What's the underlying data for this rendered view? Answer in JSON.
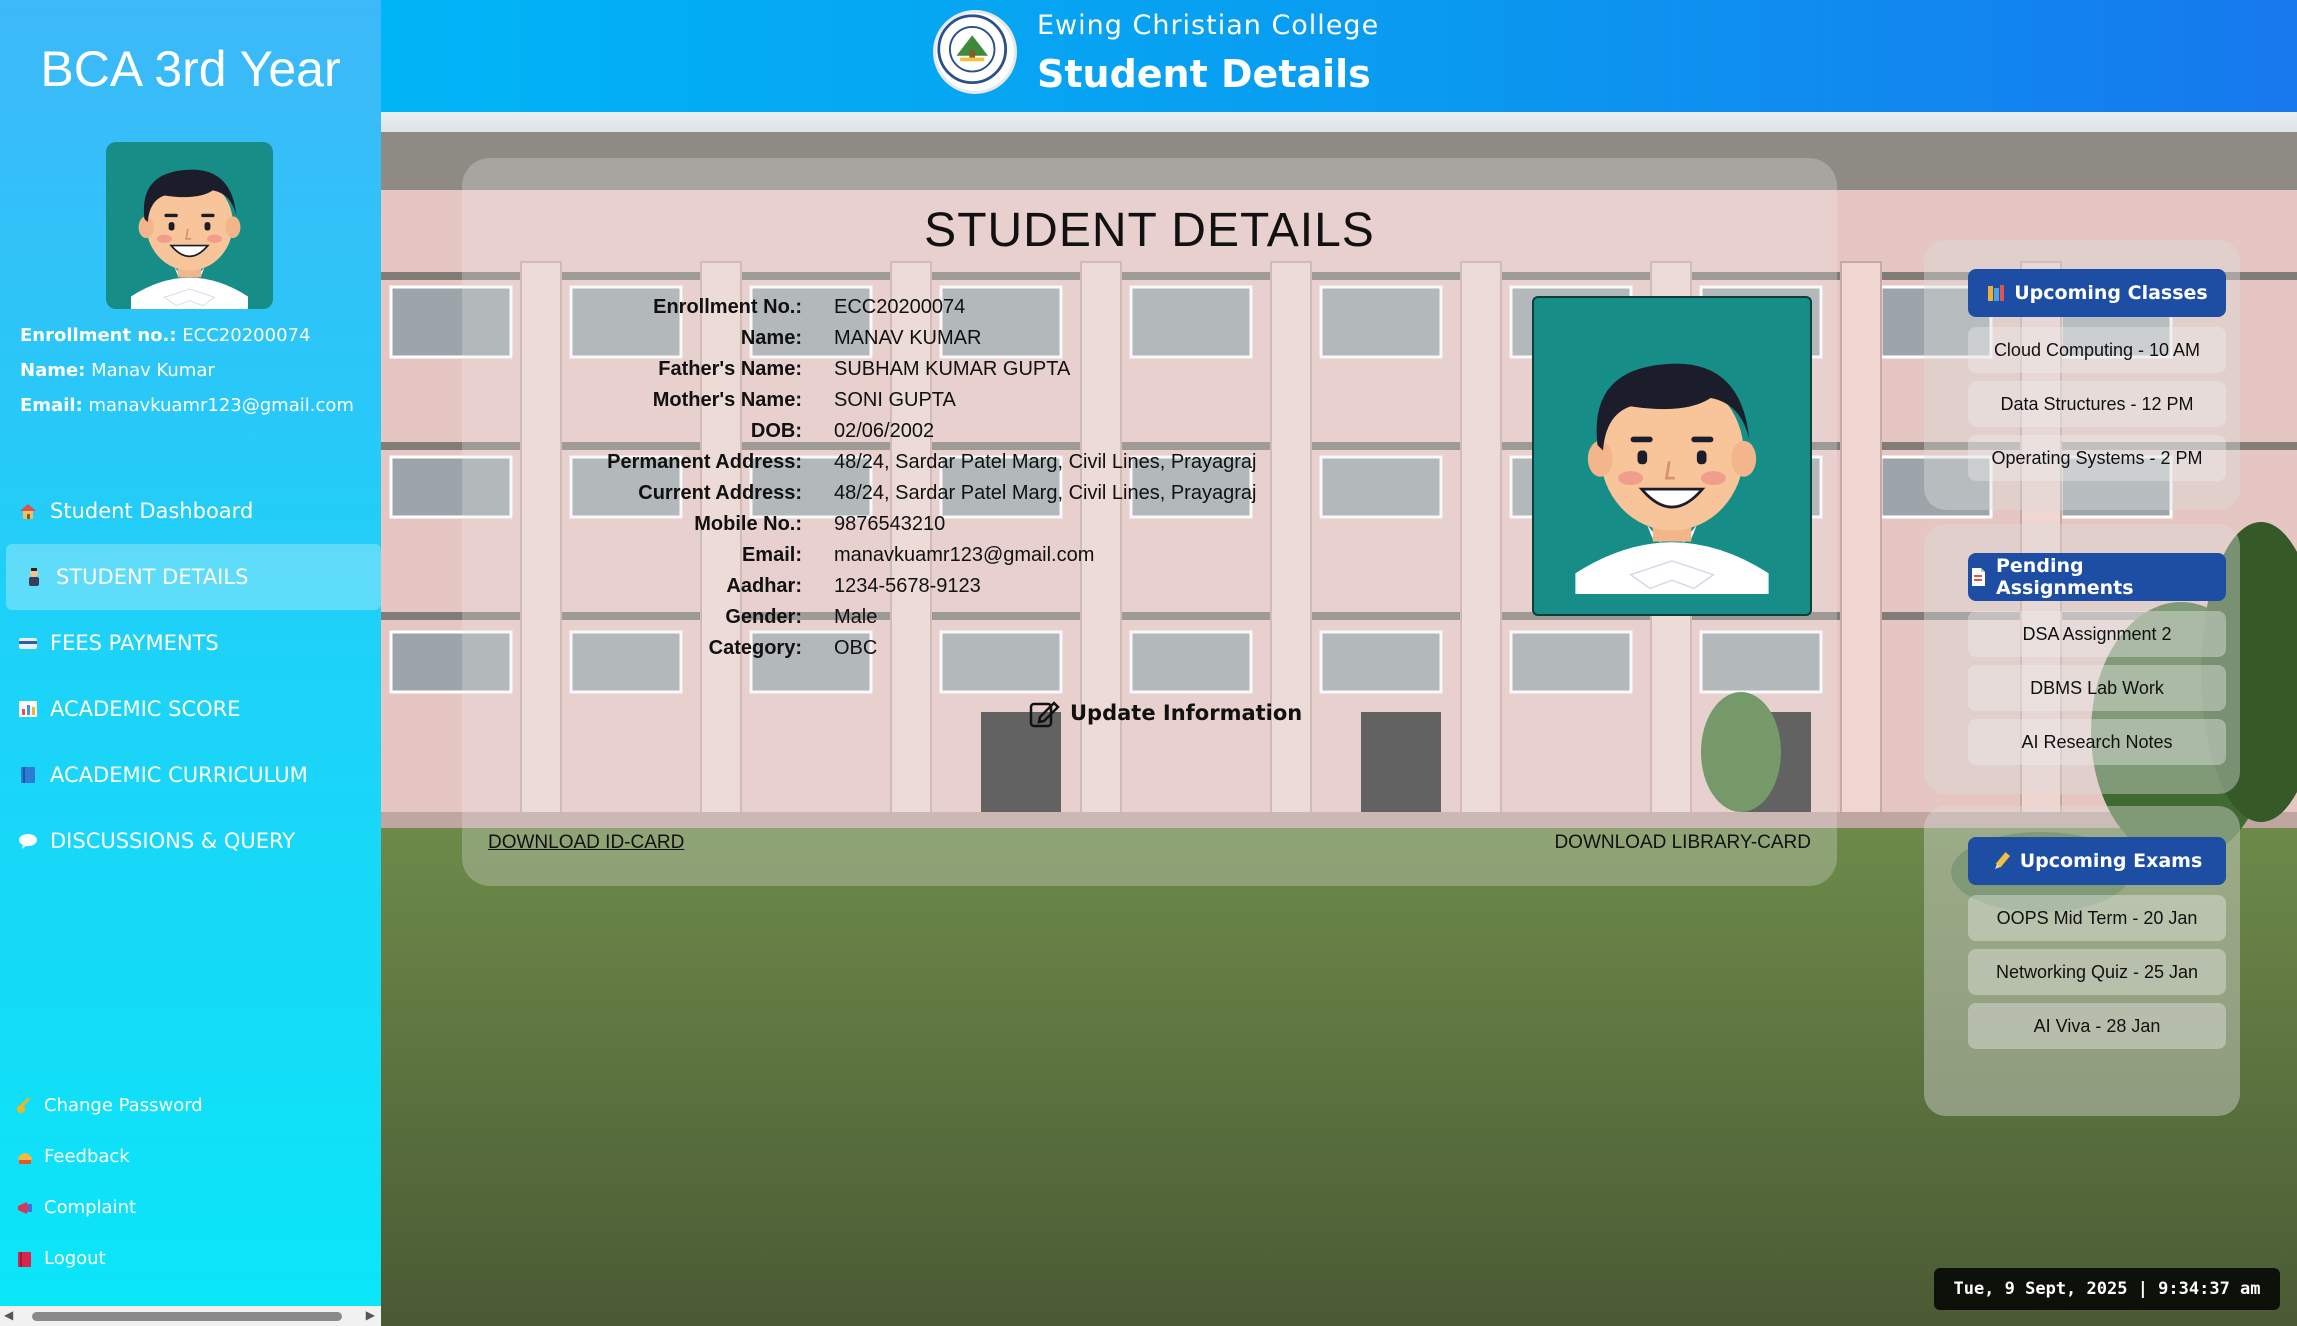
{
  "sidebar": {
    "title": "BCA 3rd Year",
    "info": {
      "enrollment_label": "Enrollment no.:",
      "enrollment_value": "ECC20200074",
      "name_label": "Name:",
      "name_value": "Manav Kumar",
      "email_label": "Email:",
      "email_value": "manavkuamr123@gmail.com"
    },
    "nav": [
      {
        "label": "Student Dashboard",
        "icon": "house-icon",
        "active": false
      },
      {
        "label": "STUDENT DETAILS",
        "icon": "student-icon",
        "active": true
      },
      {
        "label": "FEES PAYMENTS",
        "icon": "credit-card-icon",
        "active": false
      },
      {
        "label": "ACADEMIC SCORE",
        "icon": "bar-chart-icon",
        "active": false
      },
      {
        "label": "ACADEMIC CURRICULUM",
        "icon": "book-icon",
        "active": false
      },
      {
        "label": "DISCUSSIONS & QUERY",
        "icon": "speech-bubble-icon",
        "active": false
      }
    ],
    "bottom_links": [
      {
        "label": "Change Password",
        "icon": "key-icon"
      },
      {
        "label": "Feedback",
        "icon": "feedback-icon"
      },
      {
        "label": "Complaint",
        "icon": "megaphone-icon"
      },
      {
        "label": "Logout",
        "icon": "logout-icon"
      }
    ]
  },
  "header": {
    "college": "Ewing Christian College",
    "page_title": "Student Details"
  },
  "details": {
    "title": "STUDENT DETAILS",
    "fields": [
      {
        "label": "Enrollment No.:",
        "value": "ECC20200074"
      },
      {
        "label": "Name:",
        "value": "MANAV KUMAR"
      },
      {
        "label": "Father's Name:",
        "value": "SUBHAM KUMAR GUPTA"
      },
      {
        "label": "Mother's Name:",
        "value": "SONI GUPTA"
      },
      {
        "label": "DOB:",
        "value": "02/06/2002"
      },
      {
        "label": "Permanent Address:",
        "value": "48/24, Sardar Patel Marg, Civil Lines, Prayagraj"
      },
      {
        "label": "Current Address:",
        "value": "48/24, Sardar Patel Marg, Civil Lines, Prayagraj"
      },
      {
        "label": "Mobile No.:",
        "value": "9876543210"
      },
      {
        "label": "Email:",
        "value": "manavkuamr123@gmail.com"
      },
      {
        "label": "Aadhar:",
        "value": "1234-5678-9123"
      },
      {
        "label": "Gender:",
        "value": "Male"
      },
      {
        "label": "Category:",
        "value": "OBC"
      }
    ],
    "update_label": "Update Information",
    "download_id": "DOWNLOAD ID-CARD",
    "download_library": "DOWNLOAD LIBRARY-CARD"
  },
  "panels": [
    {
      "heading": "Upcoming Classes",
      "icon": "books-icon",
      "items": [
        "Cloud Computing - 10 AM",
        "Data Structures - 12 PM",
        "Operating Systems - 2 PM"
      ]
    },
    {
      "heading": "Pending Assignments",
      "icon": "document-icon",
      "items": [
        "DSA Assignment 2",
        "DBMS Lab Work",
        "AI Research Notes"
      ]
    },
    {
      "heading": "Upcoming Exams",
      "icon": "pencil-icon",
      "items": [
        "OOPS Mid Term - 20 Jan",
        "Networking Quiz - 25 Jan",
        "AI Viva - 28 Jan"
      ]
    }
  ],
  "clock": "Tue, 9 Sept, 2025 | 9:34:37 am",
  "colors": {
    "sidebar_top": "#3db8f8",
    "sidebar_bottom": "#0ae6f8",
    "header_start": "#00b5f6",
    "header_end": "#1679ee",
    "panel_heading": "#1d4ea3",
    "avatar_bg": "#168d86"
  }
}
